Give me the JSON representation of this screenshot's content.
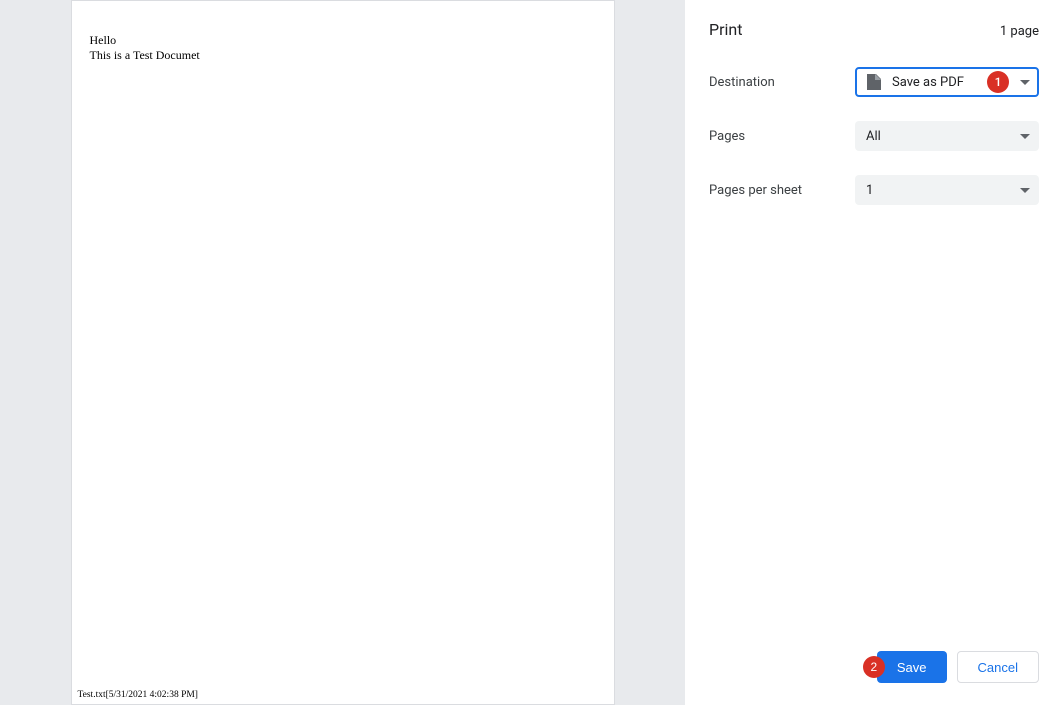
{
  "preview": {
    "line1": "Hello",
    "line2": "This is a Test Documet",
    "footer": "Test.txt[5/31/2021 4:02:38 PM]"
  },
  "panel": {
    "title": "Print",
    "page_count": "1 page",
    "destination": {
      "label": "Destination",
      "value": "Save as PDF"
    },
    "pages": {
      "label": "Pages",
      "value": "All"
    },
    "pages_per_sheet": {
      "label": "Pages per sheet",
      "value": "1"
    },
    "save_button": "Save",
    "cancel_button": "Cancel"
  },
  "annotations": {
    "one": "1",
    "two": "2"
  }
}
